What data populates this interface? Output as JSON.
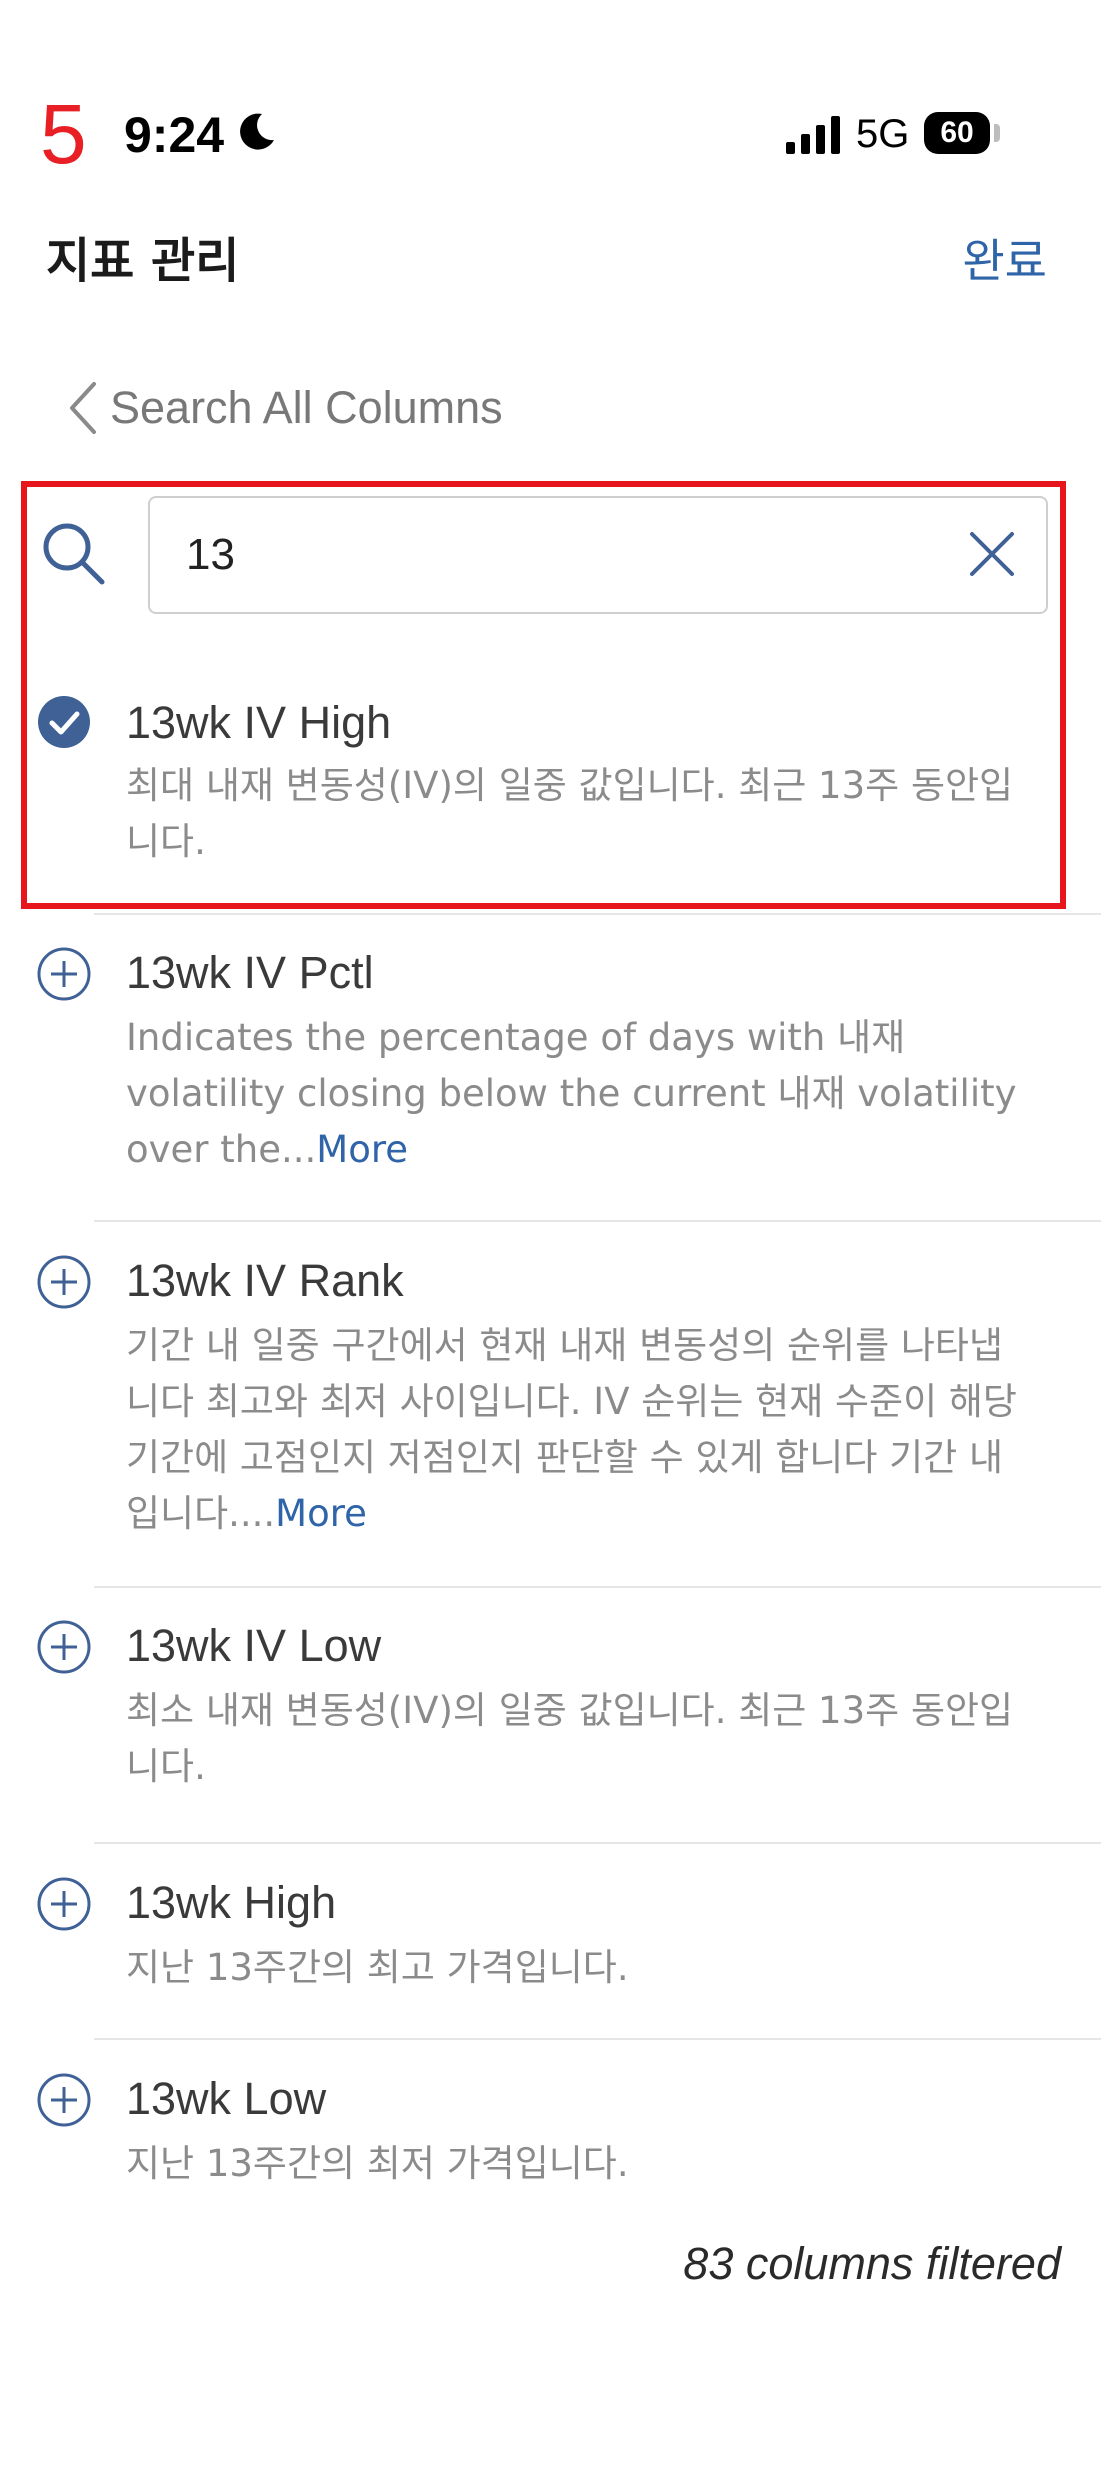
{
  "status_bar": {
    "step_number": "5",
    "time": "9:24",
    "network": "5G",
    "battery": "60"
  },
  "header": {
    "title": "지표 관리",
    "done_label": "완료"
  },
  "back": {
    "label": "Search All Columns"
  },
  "search": {
    "value": "13"
  },
  "items": [
    {
      "title": "13wk IV High",
      "desc_lines": [
        "최대 내재 변동성(IV)의 일중 값입니다. 최근 13주 동안입",
        "니다."
      ],
      "more": "",
      "state": "selected"
    },
    {
      "title": "13wk IV Pctl",
      "desc_lines": [
        "Indicates the percentage of days with 내재",
        "volatility closing below the current 내재 volatility",
        "over the..."
      ],
      "more": "More",
      "state": "add"
    },
    {
      "title": "13wk IV Rank",
      "desc_lines": [
        "기간 내 일중 구간에서 현재 내재 변동성의 순위를 나타냅",
        "니다 최고와 최저 사이입니다. IV 순위는 현재 수준이 해당",
        "기간에 고점인지 저점인지 판단할 수 있게 합니다 기간 내",
        "입니다...."
      ],
      "more": "More",
      "state": "add"
    },
    {
      "title": "13wk IV Low",
      "desc_lines": [
        "최소 내재 변동성(IV)의 일중 값입니다. 최근 13주 동안입",
        "니다."
      ],
      "more": "",
      "state": "add"
    },
    {
      "title": "13wk High",
      "desc_lines": [
        "지난 13주간의 최고 가격입니다."
      ],
      "more": "",
      "state": "add"
    },
    {
      "title": "13wk Low",
      "desc_lines": [
        "지난 13주간의 최저 가격입니다."
      ],
      "more": "",
      "state": "add"
    }
  ],
  "footer": {
    "count_text": "83 columns filtered"
  },
  "colors": {
    "accent": "#2f64a8",
    "highlight_border": "#e6161c",
    "step_number": "#e81f25",
    "selected_check": "#3f6196"
  }
}
